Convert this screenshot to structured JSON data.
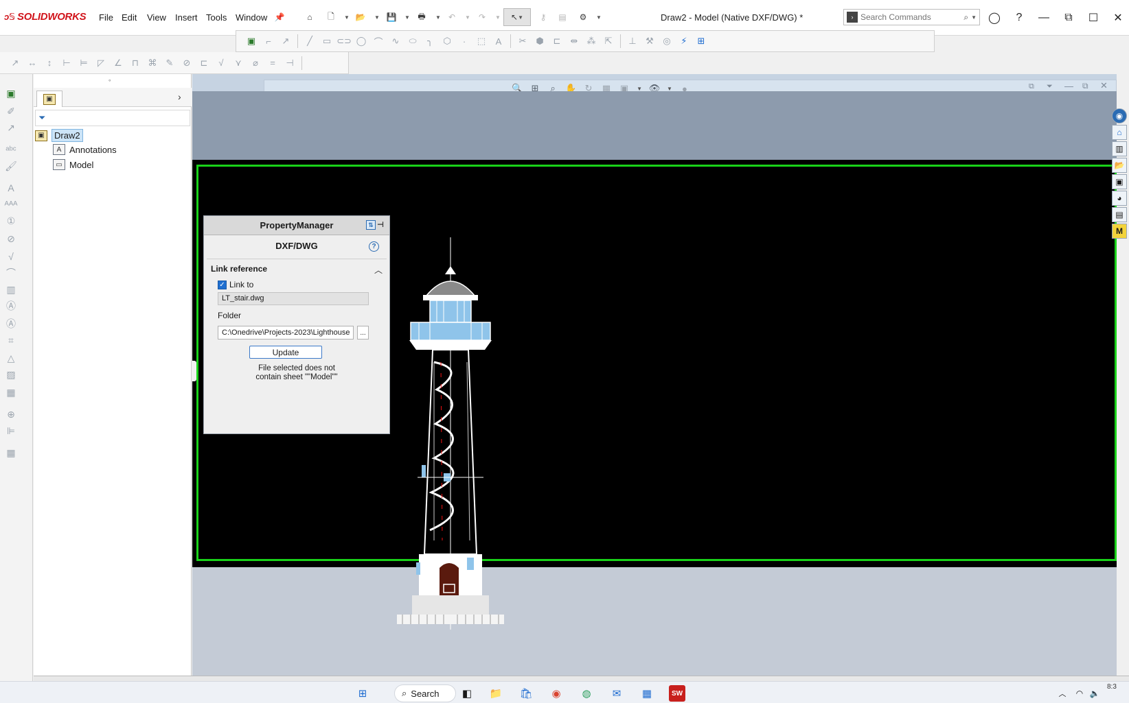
{
  "app": {
    "brand": "SOLIDWORKS",
    "doc_title": "Draw2 - Model (Native DXF/DWG) *"
  },
  "menu": [
    "File",
    "Edit",
    "View",
    "Insert",
    "Tools",
    "Window"
  ],
  "search": {
    "placeholder": "Search Commands"
  },
  "tree": {
    "root": "Draw2",
    "items": [
      "Annotations",
      "Model"
    ]
  },
  "property_manager": {
    "header": "PropertyManager",
    "title": "DXF/DWG",
    "group": "Link reference",
    "link_label": "Link to",
    "link_checked": true,
    "file": "LT_stair.dwg",
    "folder_label": "Folder",
    "folder_value": "C:\\Onedrive\\Projects-2023\\Lighthouse",
    "browse_label": "...",
    "update_label": "Update",
    "message": "File selected does not contain sheet \"\"Model\"\""
  },
  "taskbar": {
    "search_label": "Search",
    "clock": "8:3"
  },
  "colors": {
    "sheet_border": "#19d219",
    "accent": "#d1141b"
  }
}
